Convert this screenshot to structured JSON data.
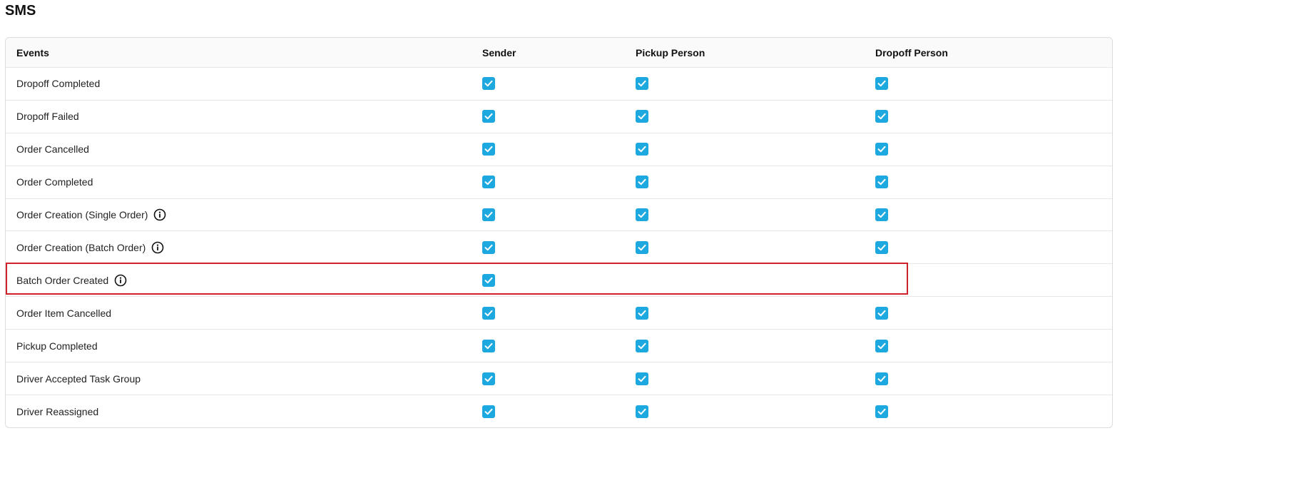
{
  "page": {
    "title": "SMS"
  },
  "table": {
    "headers": {
      "events": "Events",
      "sender": "Sender",
      "pickup": "Pickup Person",
      "dropoff": "Dropoff Person"
    },
    "rows": [
      {
        "event": "Dropoff Completed",
        "info": false,
        "sender": true,
        "pickup": true,
        "dropoff": true
      },
      {
        "event": "Dropoff Failed",
        "info": false,
        "sender": true,
        "pickup": true,
        "dropoff": true
      },
      {
        "event": "Order Cancelled",
        "info": false,
        "sender": true,
        "pickup": true,
        "dropoff": true
      },
      {
        "event": "Order Completed",
        "info": false,
        "sender": true,
        "pickup": true,
        "dropoff": true
      },
      {
        "event": "Order Creation (Single Order)",
        "info": true,
        "sender": true,
        "pickup": true,
        "dropoff": true
      },
      {
        "event": "Order Creation (Batch Order)",
        "info": true,
        "sender": true,
        "pickup": true,
        "dropoff": true
      },
      {
        "event": "Batch Order Created",
        "info": true,
        "sender": true,
        "pickup": false,
        "dropoff": false,
        "highlighted": true
      },
      {
        "event": "Order Item Cancelled",
        "info": false,
        "sender": true,
        "pickup": true,
        "dropoff": true
      },
      {
        "event": "Pickup Completed",
        "info": false,
        "sender": true,
        "pickup": true,
        "dropoff": true
      },
      {
        "event": "Driver Accepted Task Group",
        "info": false,
        "sender": true,
        "pickup": true,
        "dropoff": true
      },
      {
        "event": "Driver Reassigned",
        "info": false,
        "sender": true,
        "pickup": true,
        "dropoff": true
      }
    ]
  },
  "colors": {
    "checkbox": "#1da9e0",
    "highlight": "#d0202a"
  },
  "icons": {
    "checkbox": "checkmark-icon",
    "info": "info-circle-icon"
  }
}
